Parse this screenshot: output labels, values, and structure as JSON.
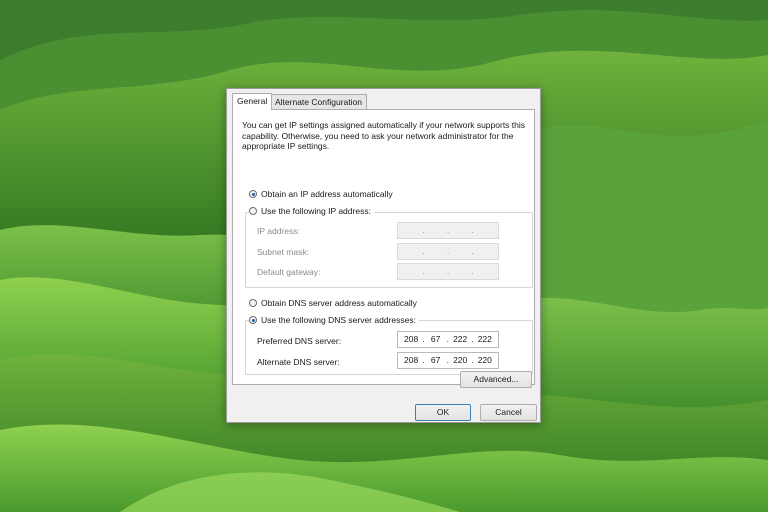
{
  "tabs": [
    {
      "label": "General",
      "active": true
    },
    {
      "label": "Alternate Configuration",
      "active": false
    }
  ],
  "intro_text": "You can get IP settings assigned automatically if your network supports this capability. Otherwise, you need to ask your network administrator for the appropriate IP settings.",
  "ip_options": {
    "auto_label": "Obtain an IP address automatically",
    "manual_label": "Use the following IP address:",
    "selected": "auto"
  },
  "ip_fields": [
    {
      "label": "IP address:",
      "value": [
        "",
        "",
        "",
        ""
      ]
    },
    {
      "label": "Subnet mask:",
      "value": [
        "",
        "",
        "",
        ""
      ]
    },
    {
      "label": "Default gateway:",
      "value": [
        "",
        "",
        "",
        ""
      ]
    }
  ],
  "dns_options": {
    "auto_label": "Obtain DNS server address automatically",
    "manual_label": "Use the following DNS server addresses:",
    "selected": "manual"
  },
  "dns_fields": [
    {
      "label": "Preferred DNS server:",
      "value": [
        "208",
        "67",
        "222",
        "222"
      ]
    },
    {
      "label": "Alternate DNS server:",
      "value": [
        "208",
        "67",
        "220",
        "220"
      ]
    }
  ],
  "buttons": {
    "advanced": "Advanced...",
    "ok": "OK",
    "cancel": "Cancel"
  },
  "colors": {
    "radio_selected": "#1c5aa6",
    "dialog_bg": "#f0f0f0",
    "panel_bg": "#ffffff"
  }
}
